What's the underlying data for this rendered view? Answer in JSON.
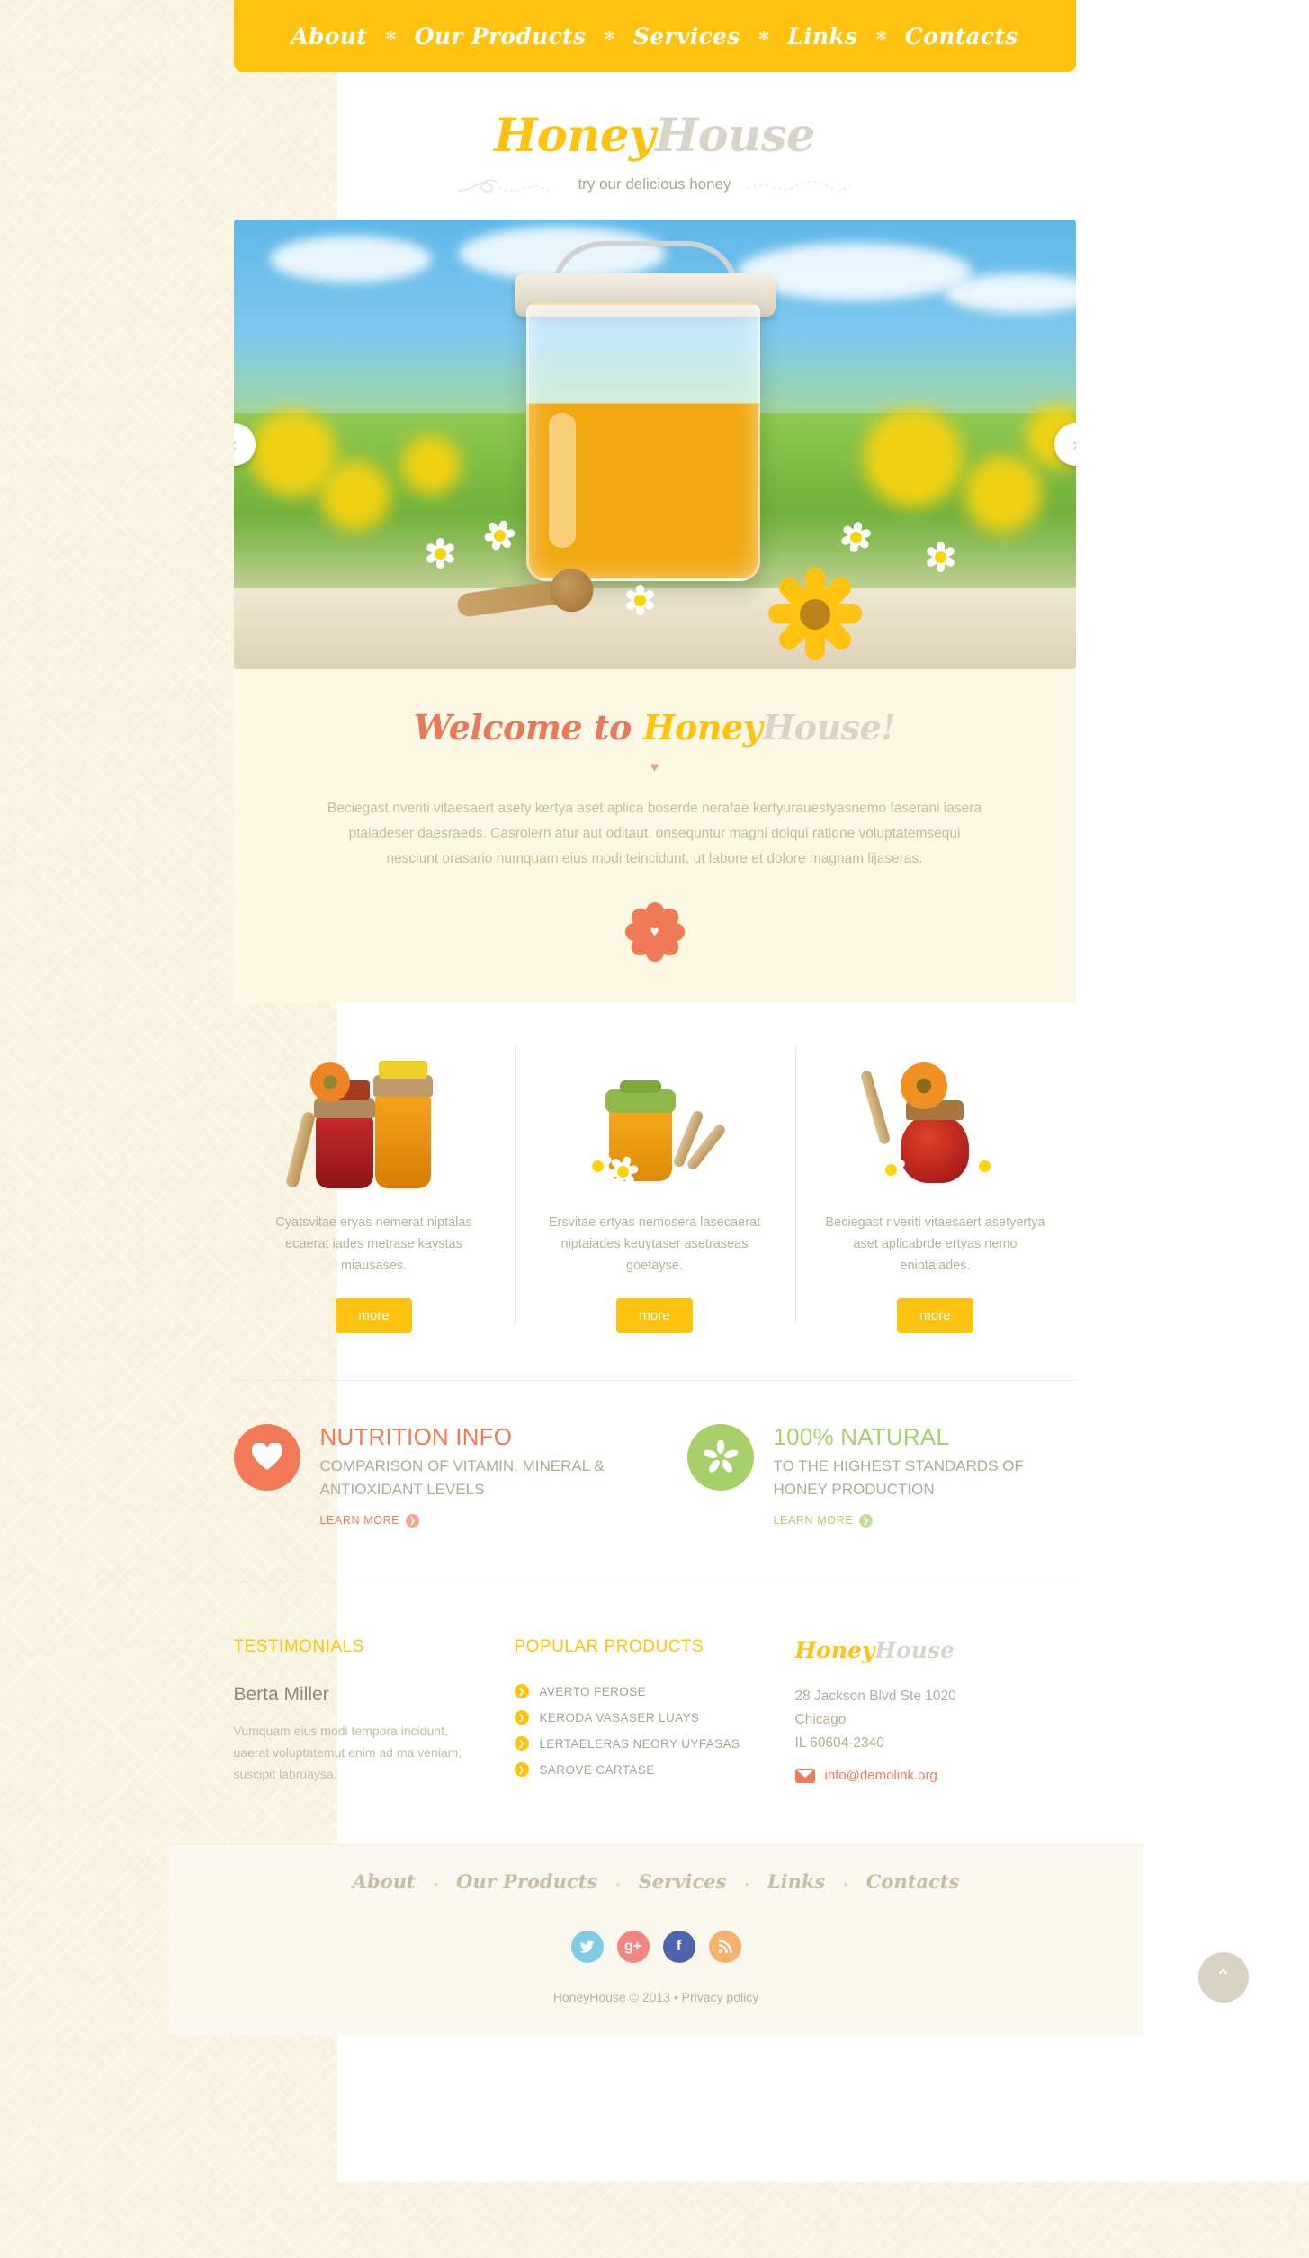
{
  "nav": {
    "items": [
      {
        "label": "About"
      },
      {
        "label": "Our Products"
      },
      {
        "label": "Services"
      },
      {
        "label": "Links"
      },
      {
        "label": "Contacts"
      }
    ],
    "separator": "✻"
  },
  "logo": {
    "part1": "Honey",
    "part2": "House"
  },
  "tagline": "try our delicious honey",
  "slider": {
    "prev_icon": "‹",
    "next_icon": "›"
  },
  "welcome": {
    "title_1": "Welcome to ",
    "title_2": "Honey",
    "title_3": "House!",
    "divider_icon": "♥",
    "body": "Beciegast nveriti vitaesaert asety kertya aset aplica boserde nerafae kertyurauestyasnemo faserani  iasera ptaiadeser daesraeds. Casrolern atur aut oditaut. onsequntur magni dolqui ratione voluptatemsequi nesciunt orasario numquam eius modi teincidunt, ut labore et dolore magnam lijaseras.",
    "flower_icon": "♥"
  },
  "products": [
    {
      "desc": "Cyatsvitae eryas nemerat niptalas ecaerat iades metrase kaystas miausases.",
      "button": "more"
    },
    {
      "desc": "Ersvitae ertyas nemosera lasecaerat niptaiades keuytaser asetraseas goetayse.",
      "button": "more"
    },
    {
      "desc": "Beciegast nveriti vitaesaert asetyertya aset aplicabrde ertyas nemo eniptaiades.",
      "button": "more"
    }
  ],
  "info": [
    {
      "title": "NUTRITION INFO",
      "subtitle": "COMPARISON OF VITAMIN, MINERAL & ANTIOXIDANT LEVELS",
      "link": "LEARN MORE",
      "icon": "heart-icon",
      "color": "#f27a56"
    },
    {
      "title": "100% NATURAL",
      "subtitle": "TO THE HIGHEST STANDARDS OF HONEY PRODUCTION",
      "link": "LEARN MORE",
      "icon": "flower-icon",
      "color": "#a8d06a"
    }
  ],
  "footer": {
    "testimonials": {
      "heading": "TESTIMONIALS",
      "author": "Berta Miller",
      "text": "Vumquam eius modi tempora incidunt, uaerat voluptatemut enim ad ma veniam, suscipit labruaysa."
    },
    "popular": {
      "heading": "POPULAR PRODUCTS",
      "items": [
        {
          "label": "AVERTO FEROSE"
        },
        {
          "label": "KERODA VASASER LUAYS"
        },
        {
          "label": "LERTAELERAS NEORY UYFASAS"
        },
        {
          "label": "SAROVE CARTASE"
        }
      ]
    },
    "contact": {
      "logo_1": "Honey",
      "logo_2": "House",
      "address_line1": "28 Jackson Blvd Ste 1020",
      "address_line2": "Chicago",
      "address_line3": "IL 60604-2340",
      "email": "info@demolink.org"
    }
  },
  "bottom": {
    "nav": [
      {
        "label": "About"
      },
      {
        "label": "Our Products"
      },
      {
        "label": "Services"
      },
      {
        "label": "Links"
      },
      {
        "label": "Contacts"
      }
    ],
    "separator": "•",
    "socials": [
      {
        "name": "twitter-icon",
        "glyph": "🐦",
        "color": "#7fcde4"
      },
      {
        "name": "google-plus-icon",
        "glyph": "g+",
        "color": "#f4867f"
      },
      {
        "name": "facebook-icon",
        "glyph": "f",
        "color": "#4d63ab"
      },
      {
        "name": "rss-icon",
        "glyph": "◗",
        "color": "#f6b26b"
      }
    ],
    "copyright": "HoneyHouse © 2013",
    "copyright_sep": "•",
    "privacy": "Privacy policy",
    "to_top_icon": "⌃"
  }
}
